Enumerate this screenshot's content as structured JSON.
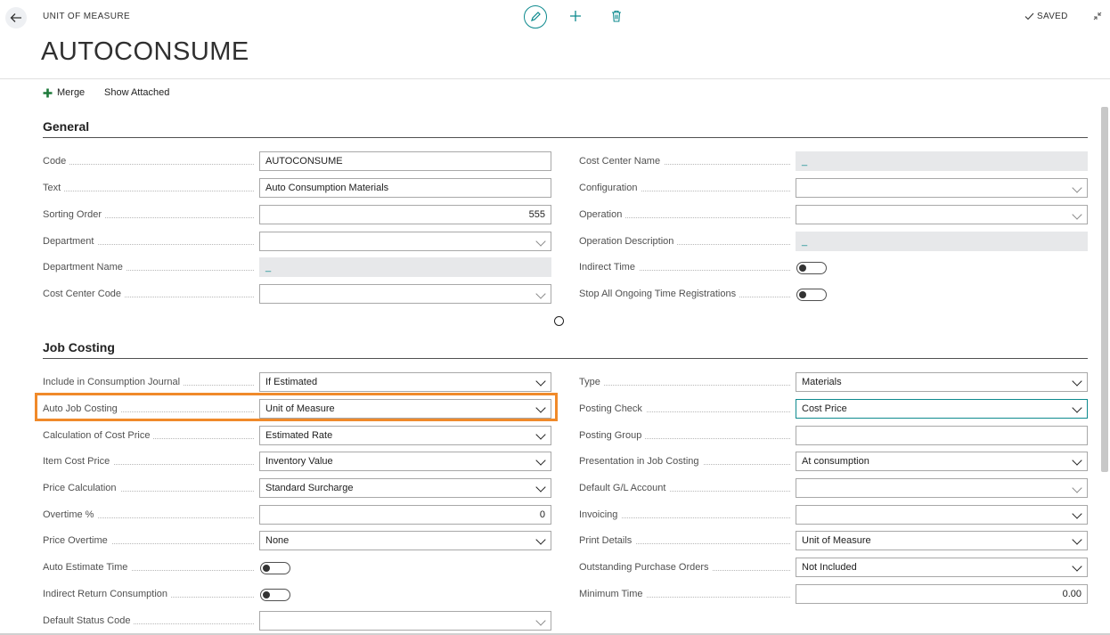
{
  "header": {
    "entity": "UNIT OF MEASURE",
    "title": "AUTOCONSUME",
    "status": "SAVED"
  },
  "icons": {
    "back": "back-arrow-icon",
    "edit": "pencil-icon",
    "add": "plus-icon",
    "delete": "trash-icon",
    "saved": "check-icon",
    "collapse": "collapse-icon"
  },
  "actions": {
    "merge": "Merge",
    "show_attached": "Show Attached"
  },
  "colors": {
    "accent": "#0d8a8e",
    "highlight": "#f08a2a",
    "merge_icon": "#1e7a3a"
  },
  "general": {
    "title": "General",
    "left": [
      {
        "label": "Code",
        "value": "AUTOCONSUME"
      },
      {
        "label": "Text",
        "value": "Auto Consumption Materials"
      },
      {
        "label": "Sorting Order",
        "value": "555"
      },
      {
        "label": "Department",
        "value": ""
      },
      {
        "label": "Department Name",
        "value": "_"
      },
      {
        "label": "Cost Center Code",
        "value": ""
      }
    ],
    "right": [
      {
        "label": "Cost Center Name",
        "value": "_"
      },
      {
        "label": "Configuration",
        "value": ""
      },
      {
        "label": "Operation",
        "value": ""
      },
      {
        "label": "Operation Description",
        "value": "_"
      },
      {
        "label": "Indirect Time",
        "value": "off"
      },
      {
        "label": "Stop All Ongoing Time Registrations",
        "value": "off"
      }
    ]
  },
  "job_costing": {
    "title": "Job Costing",
    "left": [
      {
        "label": "Include in Consumption Journal",
        "value": "If Estimated"
      },
      {
        "label": "Auto Job Costing",
        "value": "Unit of Measure"
      },
      {
        "label": "Calculation of Cost Price",
        "value": "Estimated Rate"
      },
      {
        "label": "Item Cost Price",
        "value": "Inventory Value"
      },
      {
        "label": "Price Calculation",
        "value": "Standard Surcharge"
      },
      {
        "label": "Overtime %",
        "value": "0"
      },
      {
        "label": "Price Overtime",
        "value": "None"
      },
      {
        "label": "Auto Estimate Time",
        "value": "off"
      },
      {
        "label": "Indirect Return Consumption",
        "value": "off"
      },
      {
        "label": "Default Status Code",
        "value": ""
      }
    ],
    "right": [
      {
        "label": "Type",
        "value": "Materials"
      },
      {
        "label": "Posting Check",
        "value": "Cost Price"
      },
      {
        "label": "Posting Group",
        "value": ""
      },
      {
        "label": "Presentation in Job Costing",
        "value": "At consumption"
      },
      {
        "label": "Default G/L Account",
        "value": ""
      },
      {
        "label": "Invoicing",
        "value": ""
      },
      {
        "label": "Print Details",
        "value": "Unit of Measure"
      },
      {
        "label": "Outstanding Purchase Orders",
        "value": "Not Included"
      },
      {
        "label": "Minimum Time",
        "value": "0.00"
      }
    ]
  }
}
